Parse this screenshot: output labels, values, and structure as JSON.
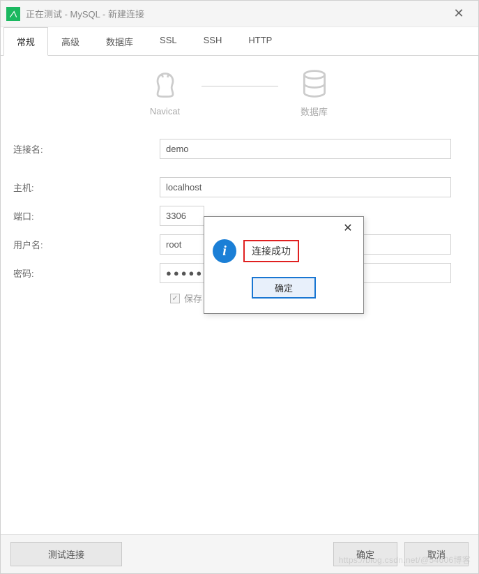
{
  "titlebar": {
    "title": "正在测试 - MySQL - 新建连接"
  },
  "tabs": [
    {
      "label": "常规",
      "active": true
    },
    {
      "label": "高级",
      "active": false
    },
    {
      "label": "数据库",
      "active": false
    },
    {
      "label": "SSL",
      "active": false
    },
    {
      "label": "SSH",
      "active": false
    },
    {
      "label": "HTTP",
      "active": false
    }
  ],
  "hero": {
    "left_label": "Navicat",
    "right_label": "数据库"
  },
  "form": {
    "connection_name_label": "连接名:",
    "connection_name_value": "demo",
    "host_label": "主机:",
    "host_value": "localhost",
    "port_label": "端口:",
    "port_value": "3306",
    "username_label": "用户名:",
    "username_value": "root",
    "password_label": "密码:",
    "password_value": "●●●●●●",
    "save_password_label": "保存"
  },
  "footer": {
    "test_label": "测试连接",
    "ok_label": "确定",
    "cancel_label": "取消"
  },
  "modal": {
    "message": "连接成功",
    "ok_label": "确定"
  },
  "watermark": "https://blog.csdn.net/@54606博客"
}
